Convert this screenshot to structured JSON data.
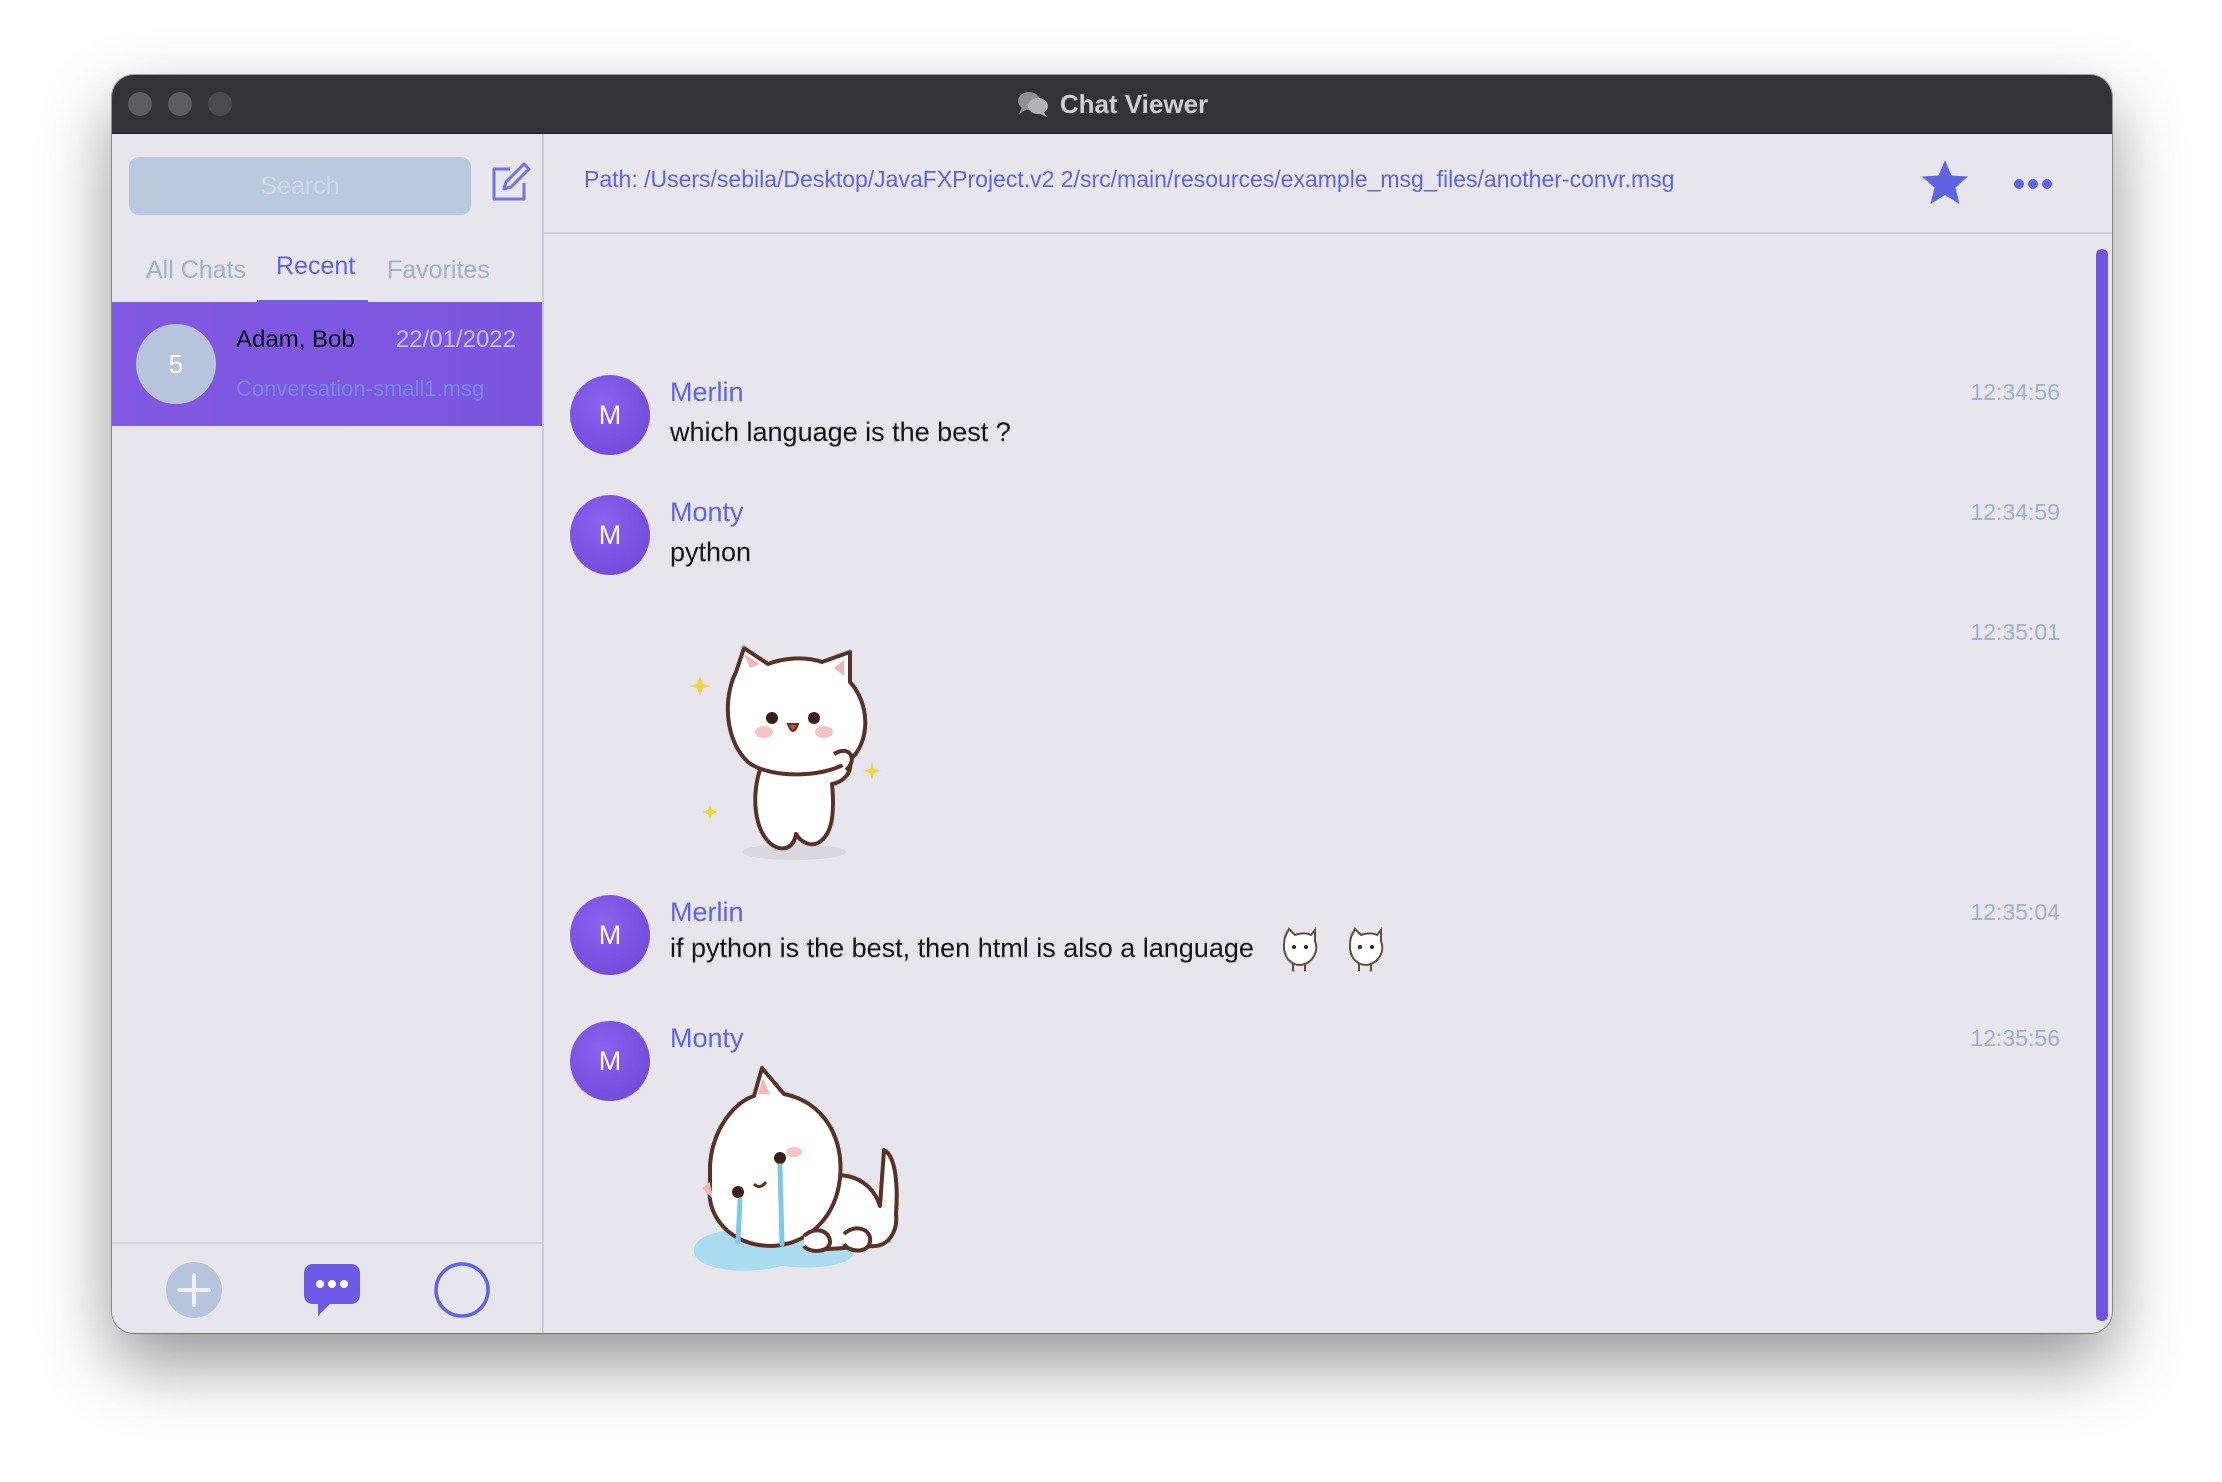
{
  "window": {
    "title": "Chat Viewer"
  },
  "sidebar": {
    "search_placeholder": "Search",
    "tabs": [
      {
        "label": "All Chats"
      },
      {
        "label": "Recent"
      },
      {
        "label": "Favorites"
      }
    ],
    "selected_tab": "Recent",
    "chats": [
      {
        "avatar": "5",
        "name": "Adam, Bob",
        "date": "22/01/2022",
        "file": "Conversation-small1.msg"
      }
    ],
    "bottom_icons": [
      "add-icon",
      "chat-bubble-icon",
      "status-circle-icon"
    ]
  },
  "conversation": {
    "path": "Path: /Users/sebila/Desktop/JavaFXProject.v2 2/src/main/resources/example_msg_files/another-convr.msg",
    "messages": [
      {
        "avatar": "M",
        "sender": "Merlin",
        "text": "which language is the best ?",
        "time": "12:34:56"
      },
      {
        "avatar": "M",
        "sender": "Monty",
        "text": "python",
        "time": "12:34:59"
      },
      {
        "time": "12:35:01",
        "sticker": "happy-cat-sticker"
      },
      {
        "avatar": "M",
        "sender": "Merlin",
        "text": "if python is the best, then html is also a language",
        "time": "12:35:04"
      },
      {
        "avatar": "M",
        "sender": "Monty",
        "time": "12:35:56",
        "sticker": "crying-cat-sticker"
      }
    ]
  },
  "colors": {
    "accent": "#5f63e6",
    "selection": "#7b57df",
    "avatar": "#7a52e3",
    "muted": "#9fb1cc",
    "titlebar": "#333236"
  }
}
